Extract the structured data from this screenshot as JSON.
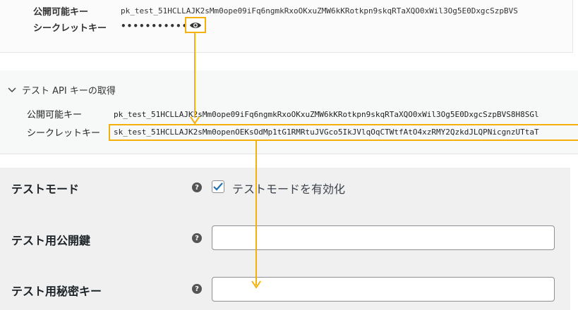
{
  "panel1": {
    "publishable_key_label": "公開可能キー",
    "publishable_key_value": "pk_test_51HCLLAJK2sMm0ope09iFq6ngmkRxoOKxuZMW6kKRotkpn9skqRTaXQO0xWil3Og5E0DxgcSzpBVS",
    "secret_key_label": "シークレットキー",
    "secret_key_masked": "••••••••••••"
  },
  "panel2": {
    "section_title": "テスト API キーの取得",
    "publishable_key_label": "公開可能キー",
    "publishable_key_value": "pk_test_51HCLLAJK2sMm0ope09iFq6ngmkRxoOKxuZMW6kKRotkpn9skqRTaXQO0xWil3Og5E0DxgcSzpBVS8H8SGl",
    "secret_key_label": "シークレットキー",
    "secret_key_value": "sk_test_51HCLLAJK2sMm0openOEKsOdMp1tG1RMRtuJVGco5IkJVlqOqCTWtfAtO4xzRMY2QzkdJLQPNicgnzUTtaT"
  },
  "settings": {
    "test_mode_label": "テストモード",
    "test_mode_checkbox_label": "テストモードを有効化",
    "test_public_key_label": "テスト用公開鍵",
    "test_secret_key_label": "テスト用秘密キー",
    "help_glyph": "?"
  },
  "colors": {
    "highlight": "#f5b10a",
    "checkbox_accent": "#2271b1"
  },
  "icons": {
    "reveal": "eye-icon",
    "collapse": "chevron-down-icon",
    "help": "help-icon",
    "check": "check-icon"
  }
}
